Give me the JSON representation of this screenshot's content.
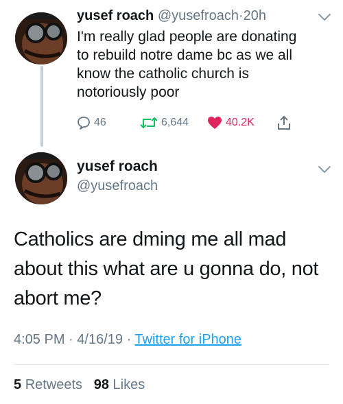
{
  "tweet1": {
    "name": "yusef roach",
    "handle": "@yusefroach",
    "separator": "·",
    "time": "20h",
    "text": "I'm really glad people are donating to rebuild notre dame bc as we all know the catholic church is notoriously poor",
    "replies": "46",
    "retweets": "6,644",
    "likes": "40.2K",
    "icons": [
      "reply-icon",
      "retweet-icon",
      "heart-icon",
      "share-icon",
      "chevron-down-icon"
    ],
    "like_color": "#e0245e"
  },
  "tweet2": {
    "name": "yusef roach",
    "handle": "@yusefroach",
    "text": "Catholics are dming me all mad about this what are u gonna do, not abort me?",
    "time": "4:05 PM",
    "date": "4/16/19",
    "source": "Twitter for iPhone",
    "retweet_count": "5",
    "retweet_label": "Retweets",
    "like_count": "98",
    "like_label": "Likes"
  },
  "colors": {
    "muted": "#657786",
    "link": "#1da1f2",
    "text": "#14171a"
  }
}
